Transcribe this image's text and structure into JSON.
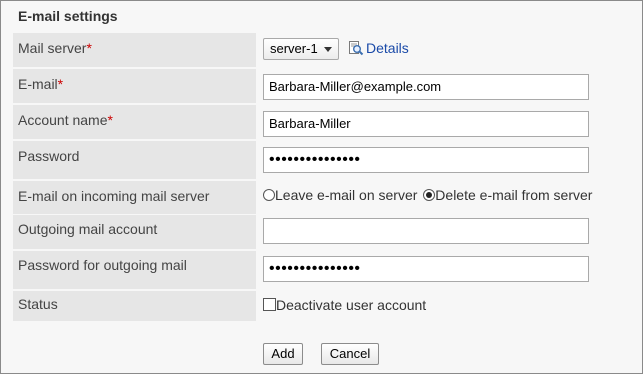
{
  "section": {
    "title": "E-mail settings"
  },
  "fields": {
    "mail_server": {
      "label": "Mail server",
      "required_mark": "*",
      "selected": "server-1",
      "details_label": "Details"
    },
    "email": {
      "label": "E-mail",
      "required_mark": "*",
      "value": "Barbara-Miller@example.com"
    },
    "account_name": {
      "label": "Account name",
      "required_mark": "*",
      "value": "Barbara-Miller"
    },
    "password": {
      "label": "Password",
      "masked_value": "•••••••••••••••"
    },
    "incoming": {
      "label": "E-mail on incoming mail server",
      "options": [
        {
          "label": "Leave e-mail on server",
          "selected": false
        },
        {
          "label": "Delete e-mail from server",
          "selected": true
        }
      ]
    },
    "outgoing_account": {
      "label": "Outgoing mail account",
      "value": ""
    },
    "outgoing_password": {
      "label": "Password for outgoing mail",
      "masked_value": "•••••••••••••••"
    },
    "status": {
      "label": "Status",
      "checkbox_label": "Deactivate user account",
      "checked": false
    }
  },
  "buttons": {
    "add": "Add",
    "cancel": "Cancel"
  },
  "colors": {
    "required": "#cc0000",
    "link": "#1a4aa8",
    "label_bg": "#e6e6e6",
    "panel_bg": "#f7f7f7"
  },
  "icons": {
    "details": "magnifier-document-icon",
    "dropdown": "caret-down-icon"
  }
}
